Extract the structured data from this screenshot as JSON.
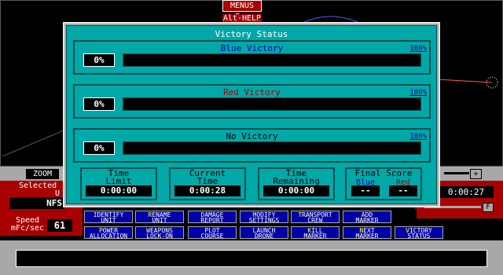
{
  "top": {
    "menus_label": "MENUS Esc",
    "help_label": "Alt-HELP"
  },
  "zoom": {
    "label": "ZOOM",
    "plus": "+"
  },
  "left_panel": {
    "selected_label": "Selected",
    "unit_prefix": "U",
    "unit_name": "NFS",
    "speed_label": "Speed\nmFc/sec",
    "speed_value": "61"
  },
  "right_panel": {
    "time": "0:00:27",
    "f_label": "F"
  },
  "commands": [
    {
      "key": "I",
      "rest": "DENTIFY",
      "line2": "UNIT"
    },
    {
      "key": "R",
      "rest": "ENAME",
      "line2": "UNIT"
    },
    {
      "key": "D",
      "rest": "AMAGE",
      "line2": "REPORT"
    },
    {
      "key": "M",
      "rest": "ODIFY",
      "line2": "SETTINGS"
    },
    {
      "key": "T",
      "rest": "RANSPORT",
      "line2": "CREW"
    },
    {
      "key": "A",
      "rest": "DD",
      "line2": "MARKER"
    },
    {
      "key": "P",
      "rest": "OWER",
      "line2": "ALLOCATION"
    },
    {
      "key": "W",
      "rest": "EAPONS",
      "line2": "LOCK-ON"
    },
    {
      "key": "",
      "rest": "PLOT",
      "line2": "COURSE"
    },
    {
      "key": "L",
      "rest": "AUNCH",
      "line2": "DRONE"
    },
    {
      "key": "K",
      "rest": "ILL",
      "line2": "MARKER"
    },
    {
      "key": "N",
      "rest": "EXT",
      "line2": "MARKER"
    },
    {
      "key": "V",
      "rest": "ICTORY",
      "line2": "STATUS"
    }
  ],
  "dialog": {
    "title": "Victory Status",
    "blue": {
      "label": "Blue Victory",
      "value": "0%",
      "max": "100%",
      "progress": 0
    },
    "red": {
      "label": "Red Victory",
      "value": "0%",
      "max": "100%",
      "progress": 0
    },
    "none": {
      "label": "No Victory",
      "value": "0%",
      "max": "100%",
      "progress": 0
    },
    "time_limit": {
      "label": "Time\nLimit",
      "value": "0:00:00"
    },
    "current_time": {
      "label": "Current\nTime",
      "value": "0:00:28"
    },
    "time_remaining": {
      "label": "Time\nRemaining",
      "value": "0:00:00"
    },
    "final_score": {
      "label": "Final Score",
      "blue_label": "Blue",
      "red_label": "Red",
      "blue_value": "--",
      "red_value": "--"
    }
  },
  "colors": {
    "blue_text": "#0000a8",
    "red_text": "#a80000",
    "panel": "#00a8a8"
  }
}
